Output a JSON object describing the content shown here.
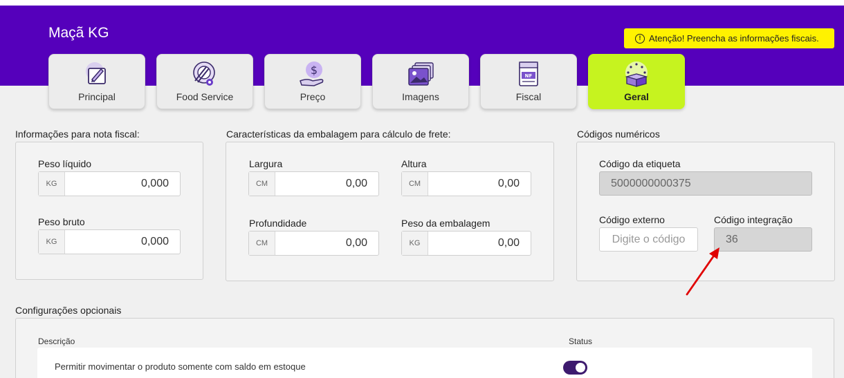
{
  "product": {
    "title": "Maçã KG"
  },
  "alert": {
    "text": "Atenção! Preencha as informações fiscais.",
    "icon": "exclamation-circle-icon"
  },
  "tabs": [
    {
      "label": "Principal",
      "icon": "pencil-icon"
    },
    {
      "label": "Food Service",
      "icon": "plate-cutlery-icon"
    },
    {
      "label": "Preço",
      "icon": "dollar-hand-icon"
    },
    {
      "label": "Imagens",
      "icon": "images-icon"
    },
    {
      "label": "Fiscal",
      "icon": "nf-document-icon"
    },
    {
      "label": "Geral",
      "icon": "box-icon",
      "active": true
    }
  ],
  "fiscal": {
    "title": "Informações para nota fiscal:",
    "peso_liquido": {
      "label": "Peso líquido",
      "unit": "KG",
      "value": "0,000"
    },
    "peso_bruto": {
      "label": "Peso bruto",
      "unit": "KG",
      "value": "0,000"
    }
  },
  "embalagem": {
    "title": "Características da embalagem para cálculo de frete:",
    "largura": {
      "label": "Largura",
      "unit": "CM",
      "value": "0,00"
    },
    "altura": {
      "label": "Altura",
      "unit": "CM",
      "value": "0,00"
    },
    "profundidade": {
      "label": "Profundidade",
      "unit": "CM",
      "value": "0,00"
    },
    "peso_embalagem": {
      "label": "Peso da embalagem",
      "unit": "KG",
      "value": "0,00"
    }
  },
  "codigos": {
    "title": "Códigos numéricos",
    "etiqueta": {
      "label": "Código da etiqueta",
      "value": "5000000000375"
    },
    "externo": {
      "label": "Código externo",
      "placeholder": "Digite o código"
    },
    "integracao": {
      "label": "Código integração",
      "value": "36"
    }
  },
  "opcionais": {
    "title": "Configurações opcionais",
    "col_descricao": "Descrição",
    "col_status": "Status",
    "rows": [
      {
        "text": "Permitir movimentar o produto somente com saldo em estoque",
        "status": true
      }
    ]
  },
  "colors": {
    "header": "#5500bb",
    "active_tab": "#c6f31f",
    "alert": "#fff200",
    "toggle": "#3d1a6e",
    "annotation_arrow": "#e00000"
  }
}
